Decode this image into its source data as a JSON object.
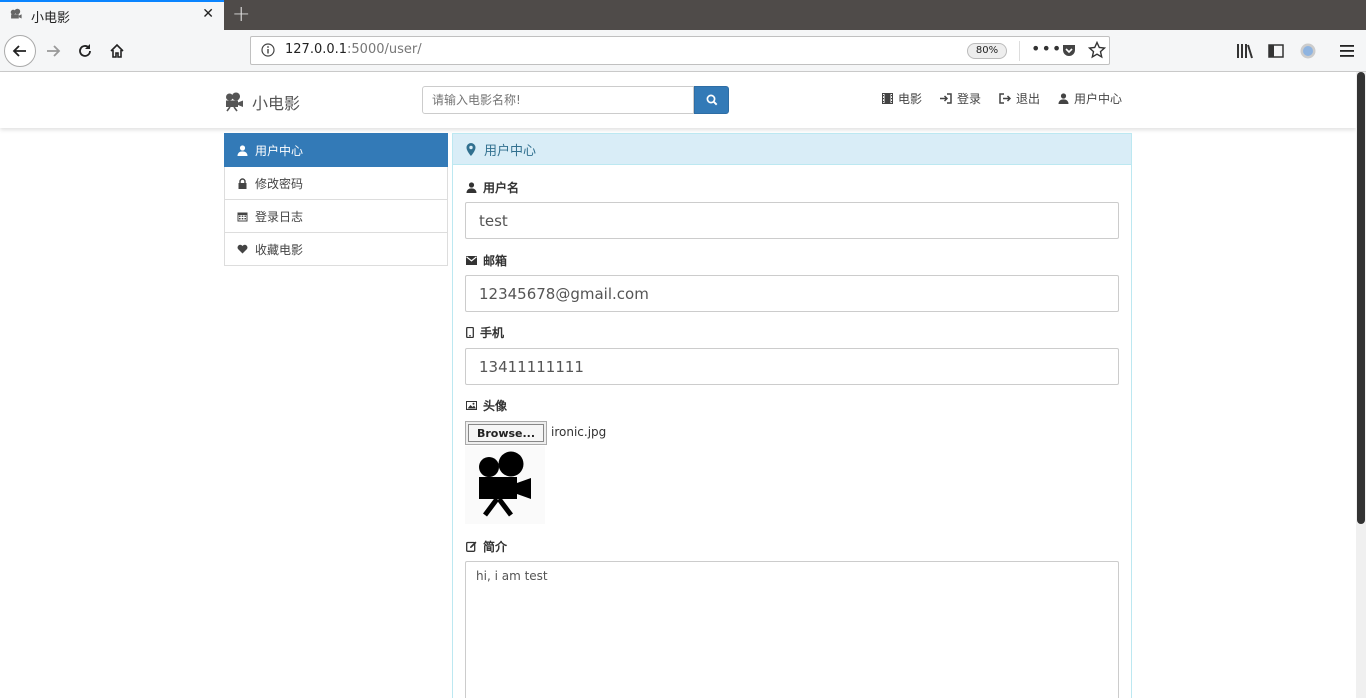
{
  "browser": {
    "tab_title": "小电影",
    "url_host": "127.0.0.1",
    "url_rest": ":5000/user/",
    "zoom": "80%"
  },
  "header": {
    "brand": "小电影",
    "search_placeholder": "请输入电影名称!",
    "nav": [
      {
        "label": "电影",
        "icon": "film-icon"
      },
      {
        "label": "登录",
        "icon": "login-icon"
      },
      {
        "label": "退出",
        "icon": "logout-icon"
      },
      {
        "label": "用户中心",
        "icon": "user-icon"
      }
    ]
  },
  "sidebar": {
    "items": [
      {
        "label": "用户中心",
        "icon": "user-icon",
        "active": true
      },
      {
        "label": "修改密码",
        "icon": "lock-icon"
      },
      {
        "label": "登录日志",
        "icon": "calendar-icon"
      },
      {
        "label": "收藏电影",
        "icon": "heart-icon"
      }
    ]
  },
  "panel": {
    "title": "用户中心",
    "username_label": "用户名",
    "username": "test",
    "email_label": "邮箱",
    "email": "12345678@gmail.com",
    "phone_label": "手机",
    "phone": "13411111111",
    "avatar_label": "头像",
    "browse_label": "Browse...",
    "file_name": "ironic.jpg",
    "intro_label": "简介",
    "intro": "hi, i am test"
  },
  "colors": {
    "primary": "#337ab7",
    "panel_heading_bg": "#d9edf7",
    "panel_heading_text": "#31708f"
  }
}
